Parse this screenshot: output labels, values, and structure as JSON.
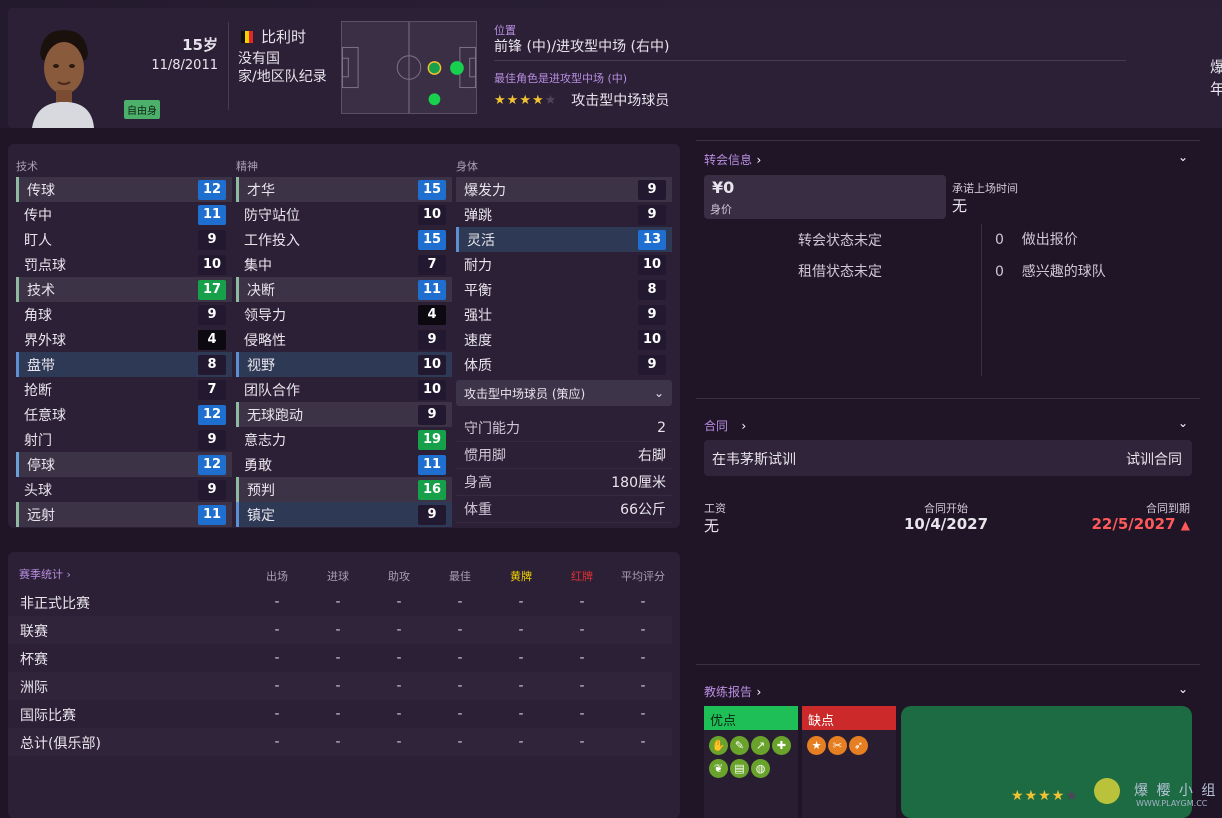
{
  "header": {
    "age": "15岁",
    "dob": "11/8/2011",
    "free_badge": "自由身",
    "nationality": "比利时",
    "no_intl_line1": "没有国",
    "no_intl_line2": "家/地区队纪录",
    "position_label": "位置",
    "position_value": "前锋 (中)/进攻型中场 (右中)",
    "best_role_label": "最佳角色是进攻型中场 (中)",
    "role_stars": 4,
    "role_name": "攻击型中场球员",
    "edge_text_1": "爆",
    "edge_text_2": "年",
    "flag_colors": [
      "#111111",
      "#f4d000",
      "#e3262c"
    ]
  },
  "attributes": {
    "technical_title": "技术",
    "mental_title": "精神",
    "physical_title": "身体",
    "technical": [
      {
        "name": "传球",
        "value": "12"
      },
      {
        "name": "传中",
        "value": "11"
      },
      {
        "name": "盯人",
        "value": "9"
      },
      {
        "name": "罚点球",
        "value": "10"
      },
      {
        "name": "技术",
        "value": "17"
      },
      {
        "name": "角球",
        "value": "9"
      },
      {
        "name": "界外球",
        "value": "4"
      },
      {
        "name": "盘带",
        "value": "8"
      },
      {
        "name": "抢断",
        "value": "7"
      },
      {
        "name": "任意球",
        "value": "12"
      },
      {
        "name": "射门",
        "value": "9"
      },
      {
        "name": "停球",
        "value": "12"
      },
      {
        "name": "头球",
        "value": "9"
      },
      {
        "name": "远射",
        "value": "11"
      }
    ],
    "mental": [
      {
        "name": "才华",
        "value": "15"
      },
      {
        "name": "防守站位",
        "value": "10"
      },
      {
        "name": "工作投入",
        "value": "15"
      },
      {
        "name": "集中",
        "value": "7"
      },
      {
        "name": "决断",
        "value": "11"
      },
      {
        "name": "领导力",
        "value": "4"
      },
      {
        "name": "侵略性",
        "value": "9"
      },
      {
        "name": "视野",
        "value": "10"
      },
      {
        "name": "团队合作",
        "value": "10"
      },
      {
        "name": "无球跑动",
        "value": "9"
      },
      {
        "name": "意志力",
        "value": "19"
      },
      {
        "name": "勇敢",
        "value": "11"
      },
      {
        "name": "预判",
        "value": "16"
      },
      {
        "name": "镇定",
        "value": "9"
      }
    ],
    "physical": [
      {
        "name": "爆发力",
        "value": "9"
      },
      {
        "name": "弹跳",
        "value": "9"
      },
      {
        "name": "灵活",
        "value": "13"
      },
      {
        "name": "耐力",
        "value": "10"
      },
      {
        "name": "平衡",
        "value": "8"
      },
      {
        "name": "强壮",
        "value": "9"
      },
      {
        "name": "速度",
        "value": "10"
      },
      {
        "name": "体质",
        "value": "9"
      }
    ],
    "role_select": "攻击型中场球员 (策应)",
    "info": [
      {
        "label": "守门能力",
        "value": "2"
      },
      {
        "label": "惯用脚",
        "value": "右脚"
      },
      {
        "label": "身高",
        "value": "180厘米"
      },
      {
        "label": "体重",
        "value": "66公斤"
      }
    ]
  },
  "season_stats": {
    "title": "赛季统计",
    "columns": [
      "出场",
      "进球",
      "助攻",
      "最佳",
      "黄牌",
      "红牌",
      "平均评分"
    ],
    "column_colors": {
      "yellow": "#f1d000",
      "red": "#e0302f"
    },
    "rows": [
      {
        "label": "非正式比赛",
        "cells": [
          "-",
          "-",
          "-",
          "-",
          "-",
          "-",
          "-"
        ]
      },
      {
        "label": "联赛",
        "cells": [
          "-",
          "-",
          "-",
          "-",
          "-",
          "-",
          "-"
        ]
      },
      {
        "label": "杯赛",
        "cells": [
          "-",
          "-",
          "-",
          "-",
          "-",
          "-",
          "-"
        ]
      },
      {
        "label": "洲际",
        "cells": [
          "-",
          "-",
          "-",
          "-",
          "-",
          "-",
          "-"
        ]
      },
      {
        "label": "国际比赛",
        "cells": [
          "-",
          "-",
          "-",
          "-",
          "-",
          "-",
          "-"
        ]
      },
      {
        "label": "总计(俱乐部)",
        "cells": [
          "-",
          "-",
          "-",
          "-",
          "-",
          "-",
          "-"
        ]
      }
    ]
  },
  "transfer": {
    "title": "转会信息",
    "value": "¥0",
    "value_label": "身价",
    "promise_label": "承诺上场时间",
    "promise_value": "无",
    "transfer_status": "转会状态未定",
    "loan_status": "租借状态未定",
    "offers_count": "0",
    "offers_label": "做出报价",
    "interest_count": "0",
    "interest_label": "感兴趣的球队"
  },
  "contract": {
    "title": "合同",
    "club_trial": "在韦茅斯试训",
    "contract_type": "试训合同",
    "wage_label": "工资",
    "wage_value": "无",
    "start_label": "合同开始",
    "start_value": "10/4/2027",
    "end_label": "合同到期",
    "end_value": "22/5/2027",
    "end_color": "#ff5a5a"
  },
  "coach_report": {
    "title": "教练报告",
    "strengths_label": "优点",
    "weaknesses_label": "缺点",
    "strength_icons": [
      "glove-icon",
      "wrench-icon",
      "chart-icon",
      "bandage-icon",
      "leaf-icon",
      "ticket-icon",
      "globe-icon"
    ],
    "weakness_icons": [
      "star-icon",
      "scissors-icon",
      "runner-icon"
    ],
    "card_stars": 4,
    "watermark": "爆 樱 小 组",
    "watermark_url": "WWW.PLAYGM.CC"
  }
}
